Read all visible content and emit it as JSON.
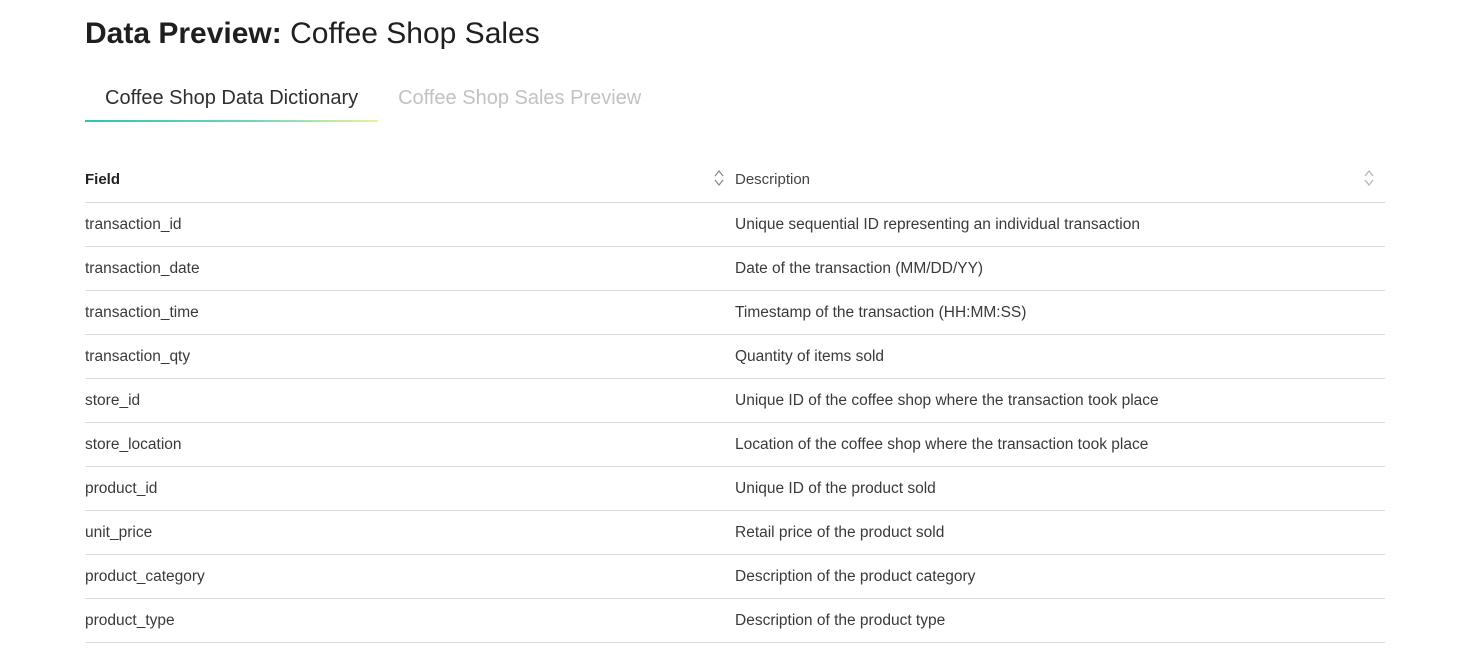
{
  "page": {
    "title_prefix": "Data Preview:",
    "title_suffix": " Coffee Shop Sales"
  },
  "tabs": [
    {
      "label": "Coffee Shop Data Dictionary",
      "active": true
    },
    {
      "label": "Coffee Shop Sales Preview",
      "active": false
    }
  ],
  "table": {
    "columns": [
      "Field",
      "Description"
    ],
    "rows": [
      {
        "field": "transaction_id",
        "description": "Unique sequential ID representing an individual transaction"
      },
      {
        "field": "transaction_date",
        "description": "Date of the transaction (MM/DD/YY)"
      },
      {
        "field": "transaction_time",
        "description": "Timestamp of the transaction (HH:MM:SS)"
      },
      {
        "field": "transaction_qty",
        "description": "Quantity of items sold"
      },
      {
        "field": "store_id",
        "description": "Unique ID of the coffee shop where the transaction took place"
      },
      {
        "field": "store_location",
        "description": "Location of the coffee shop where the transaction took place"
      },
      {
        "field": "product_id",
        "description": "Unique ID of the product sold"
      },
      {
        "field": "unit_price",
        "description": "Retail price of the product sold"
      },
      {
        "field": "product_category",
        "description": "Description of the product category"
      },
      {
        "field": "product_type",
        "description": "Description of the product type"
      }
    ]
  },
  "icons": {
    "sort": "sort-icon"
  },
  "colors": {
    "tab_underline_start": "#2ec4b6",
    "tab_underline_end": "#e4f5a0",
    "inactive_tab_text": "#c2c2c2"
  }
}
